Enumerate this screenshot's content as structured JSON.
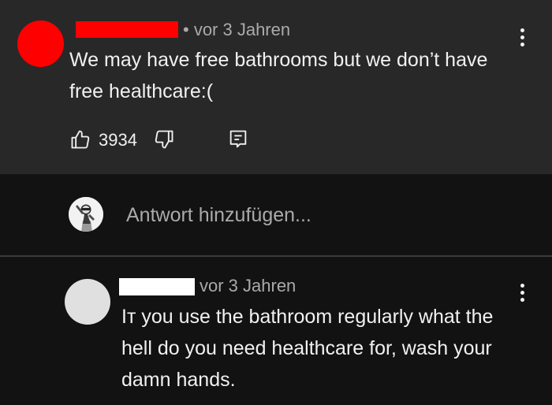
{
  "top_comment": {
    "avatar_color": "#ff0000",
    "timestamp": "• vor 3 Jahren",
    "text": "We may have free bathrooms but we don’t have free healthcare:(",
    "like_count": "3934",
    "icons": {
      "like": "thumbs-up-icon",
      "dislike": "thumbs-down-icon",
      "reply": "comment-reply-icon",
      "menu": "more-vert-icon"
    }
  },
  "add_reply": {
    "placeholder": "Antwort hinzufügen..."
  },
  "reply_comment": {
    "avatar_color": "#e0e0e0",
    "timestamp": "vor 3 Jahren",
    "text": "Iт you use the bathroom regularly what the hell do you need healthcare for, wash your damn hands."
  },
  "colors": {
    "top_background": "#282828",
    "reply_background": "#121212",
    "text_primary": "#f1f1f1",
    "text_secondary": "#aaaaaa",
    "redaction_red": "#ff0000",
    "redaction_white": "#ffffff"
  }
}
